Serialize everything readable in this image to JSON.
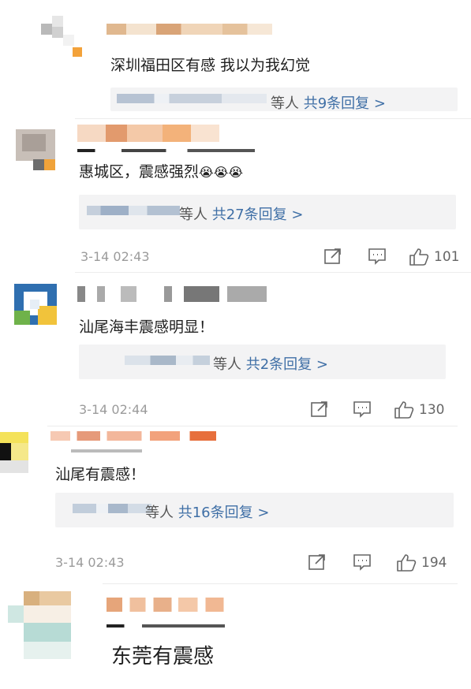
{
  "comments": [
    {
      "text": "深圳福田区有感 我以为我幻觉",
      "replies": {
        "etc": "等人",
        "count": "共9条回复 >"
      }
    },
    {
      "text": "惠城区，震感强烈",
      "emoji": [
        "😭",
        "😭",
        "😭"
      ],
      "replies": {
        "etc": "等人",
        "count": "共27条回复 >"
      },
      "time": "3-14 02:43",
      "likes": "101"
    },
    {
      "text": "汕尾海丰震感明显！",
      "replies": {
        "etc": "等人",
        "count": "共2条回复 >"
      },
      "time": "3-14 02:44",
      "likes": "130"
    },
    {
      "text": "汕尾有震感！",
      "replies": {
        "etc": "等人",
        "count": "共16条回复 >"
      },
      "time": "3-14 02:43",
      "likes": "194"
    },
    {
      "text": "东莞有震感"
    }
  ],
  "icons": {
    "share": "share-icon",
    "comment": "comment-icon",
    "like": "thumbs-up-icon"
  },
  "colors": {
    "link": "#3f6fa6",
    "meta": "#9b9b9b",
    "reply_bg": "#f3f3f4"
  }
}
